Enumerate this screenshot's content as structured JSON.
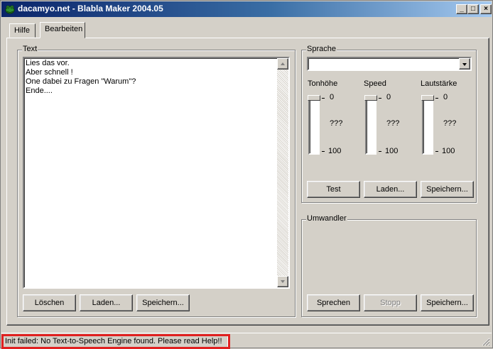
{
  "window": {
    "title": "dacamyo.net - Blabla Maker 2004.05",
    "controls": {
      "minimize": "_",
      "maximize": "□",
      "close": "×"
    }
  },
  "tabs": [
    {
      "label": "Hilfe",
      "active": false
    },
    {
      "label": "Bearbeiten",
      "active": true
    }
  ],
  "text_group": {
    "label": "Text",
    "lines": [
      "Lies das vor.",
      "Aber schnell !",
      "One dabei zu Fragen \"Warum\"?",
      "Ende...."
    ],
    "buttons": {
      "clear": "Löschen",
      "load": "Laden...",
      "save": "Speichern..."
    }
  },
  "language_group": {
    "label": "Sprache",
    "selected_voice": "",
    "sliders": [
      {
        "label": "Tonhöhe",
        "value_text": "???",
        "min_label": "0",
        "max_label": "100"
      },
      {
        "label": "Speed",
        "value_text": "???",
        "min_label": "0",
        "max_label": "100"
      },
      {
        "label": "Lautstärke",
        "value_text": "???",
        "min_label": "0",
        "max_label": "100"
      }
    ],
    "buttons": {
      "test": "Test",
      "load": "Laden...",
      "save": "Speichern..."
    }
  },
  "converter_group": {
    "label": "Umwandler",
    "buttons": {
      "speak": "Sprechen",
      "stop": "Stopp",
      "save": "Speichern..."
    }
  },
  "status_bar": {
    "message": "Init failed: No Text-to-Speech Engine found. Please read Help!!",
    "highlight_color": "#e02020"
  },
  "colors": {
    "face": "#d4d0c8",
    "titlebar_start": "#0a246a",
    "titlebar_end": "#a6caf0"
  }
}
